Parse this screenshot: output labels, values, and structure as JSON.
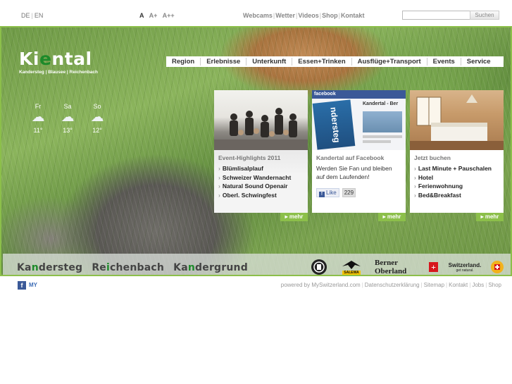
{
  "lang": {
    "items": [
      "DE",
      "EN"
    ]
  },
  "font_sizes": [
    "A",
    "A+",
    "A++"
  ],
  "top_links": [
    "Webcams",
    "Wetter",
    "Videos",
    "Shop",
    "Kontakt"
  ],
  "search": {
    "placeholder": "",
    "button": "Suchen"
  },
  "logo": {
    "part1": "Ki",
    "part2": "e",
    "part3": "ntal",
    "sub": "Kandersteg | Blausee | Reichenbach"
  },
  "nav": [
    "Region",
    "Erlebnisse",
    "Unterkunft",
    "Essen+Trinken",
    "Ausflüge+Transport",
    "Events",
    "Service"
  ],
  "weather": [
    {
      "day": "Fr",
      "temp": "11°",
      "icon": "cloud-icon"
    },
    {
      "day": "Sa",
      "temp": "13°",
      "icon": "cloud-icon"
    },
    {
      "day": "So",
      "temp": "12°",
      "icon": "cloud-icon"
    }
  ],
  "boxes": {
    "events": {
      "title": "Event-Highlights 2011",
      "items": [
        "Blümlisalplauf",
        "Schweizer Wandernacht",
        "Natural Sound Openair",
        "Oberl. Schwingfest"
      ],
      "more": "mehr"
    },
    "facebook": {
      "title": "Kandertal auf Facebook",
      "text": "Werden Sie Fan und bleiben auf dem Laufenden!",
      "like": "Like",
      "count": "229",
      "more": "mehr",
      "thumb_label": "facebook",
      "thumb_title": "Kandertal - Ber",
      "thumb_side": "ndersteg"
    },
    "booking": {
      "title": "Jetzt buchen",
      "items": [
        "Last Minute + Pauschalen",
        "Hotel",
        "Ferienwohnung",
        "Bed&Breakfast"
      ],
      "more": "mehr"
    }
  },
  "villages": [
    {
      "a": "Ka",
      "g": "n",
      "b": "dersteg"
    },
    {
      "a": "Re",
      "g": "i",
      "b": "chenbach"
    },
    {
      "a": "Ka",
      "g": "n",
      "b": "dergrund"
    }
  ],
  "sponsors": {
    "salewa": "SALEWA",
    "berner": "Berner Oberland",
    "switzerland": "Switzerland.",
    "switzerland_sub": "get natural."
  },
  "footer": {
    "links": [
      "powered by MySwitzerland.com",
      "Datenschutzerklärung",
      "Sitemap",
      "Kontakt",
      "Jobs",
      "Shop"
    ],
    "social": [
      "f",
      "MY"
    ]
  }
}
